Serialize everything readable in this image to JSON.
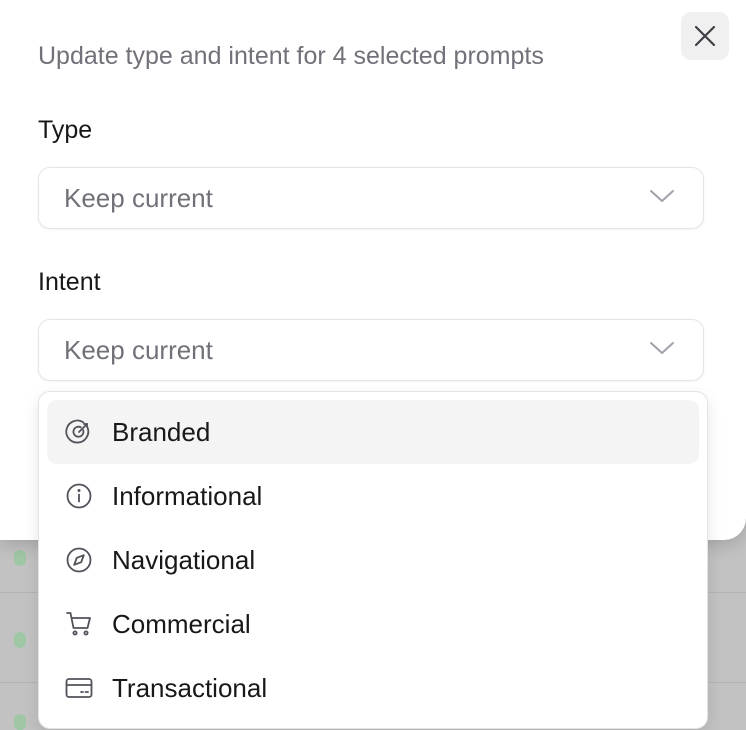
{
  "dialog": {
    "description": "Update type and intent for 4 selected prompts",
    "close_icon": "x-icon"
  },
  "type_field": {
    "label": "Type",
    "value": "Keep current"
  },
  "intent_field": {
    "label": "Intent",
    "value": "Keep current"
  },
  "intent_menu": {
    "items": [
      {
        "label": "Branded",
        "icon": "target-icon"
      },
      {
        "label": "Informational",
        "icon": "info-icon"
      },
      {
        "label": "Navigational",
        "icon": "compass-icon"
      },
      {
        "label": "Commercial",
        "icon": "cart-icon"
      },
      {
        "label": "Transactional",
        "icon": "credit-card-icon"
      }
    ],
    "highlighted": "Branded"
  },
  "colors": {
    "muted_text": "#71717a",
    "text": "#18181b",
    "border": "#e4e4e7",
    "highlight": "#f4f4f5"
  }
}
